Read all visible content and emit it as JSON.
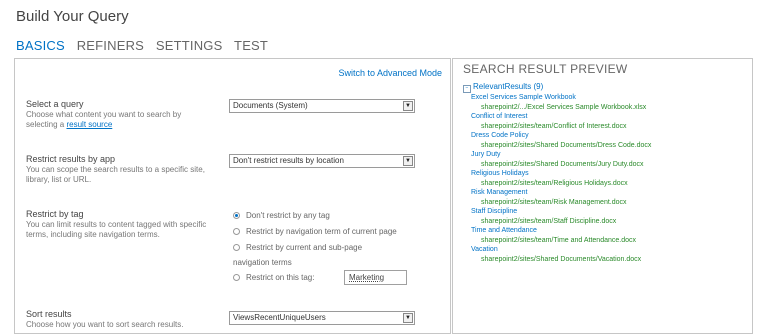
{
  "page": {
    "title": "Build Your Query"
  },
  "tabs": [
    {
      "label": "BASICS"
    },
    {
      "label": "REFINERS"
    },
    {
      "label": "SETTINGS"
    },
    {
      "label": "TEST"
    }
  ],
  "basics": {
    "advanced_link": "Switch to Advanced Mode",
    "select_query": {
      "heading": "Select a query",
      "desc": "Choose what content you want to search by selecting a",
      "link": "result source",
      "value": "Documents (System)"
    },
    "restrict_app": {
      "heading": "Restrict results by app",
      "desc": "You can scope the search results to a specific site, library, list or URL.",
      "value": "Don't restrict results by location"
    },
    "restrict_tag": {
      "heading": "Restrict by tag",
      "desc": "You can limit results to content tagged with specific terms, including site navigation terms.",
      "options": [
        "Don't restrict by any tag",
        "Restrict by navigation term of current page",
        "Restrict by current and sub-page",
        "navigation terms",
        "Restrict on this tag:"
      ],
      "tag_value": "Marketing"
    },
    "sort": {
      "heading": "Sort results",
      "desc": "Choose how you want to sort search results.",
      "value": "ViewsRecentUniqueUsers"
    }
  },
  "preview": {
    "title": "SEARCH RESULT PREVIEW",
    "root": "RelevantResults (9)",
    "results": [
      {
        "title": "Excel Services Sample Workbook",
        "url": "sharepoint2/.../Excel Services Sample Workbook.xlsx"
      },
      {
        "title": "Conflict of Interest",
        "url": "sharepoint2/sites/team/Conflict of Interest.docx"
      },
      {
        "title": "Dress Code Policy",
        "url": "sharepoint2/sites/Shared Documents/Dress Code.docx"
      },
      {
        "title": "Jury Duty",
        "url": "sharepoint2/sites/Shared Documents/Jury Duty.docx"
      },
      {
        "title": "Religious Holidays",
        "url": "sharepoint2/sites/team/Religious Holidays.docx"
      },
      {
        "title": "Risk Management",
        "url": "sharepoint2/sites/team/Risk Management.docx"
      },
      {
        "title": "Staff Discipline",
        "url": "sharepoint2/sites/team/Staff Discipline.docx"
      },
      {
        "title": "Time and Attendance",
        "url": "sharepoint2/sites/team/Time and Attendance.docx"
      },
      {
        "title": "Vacation",
        "url": "sharepoint2/sites/Shared Documents/Vacation.docx"
      }
    ]
  },
  "colors": {
    "accent": "#0072c6",
    "url_green": "#2a8a2a",
    "border": "#c6c6c6"
  }
}
